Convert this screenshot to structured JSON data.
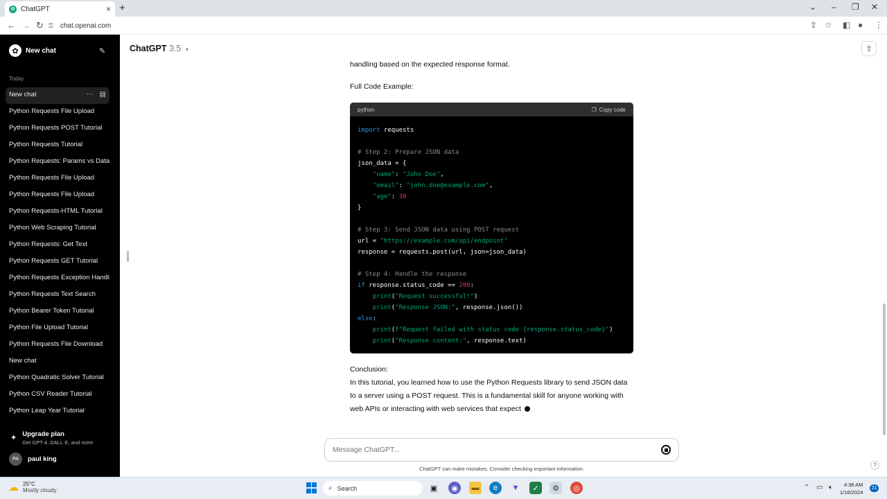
{
  "browser": {
    "tab_title": "ChatGPT",
    "url": "chat.openai.com"
  },
  "sidebar": {
    "new_chat_label": "New chat",
    "section_today": "Today",
    "history": [
      "New chat",
      "Python Requests File Upload",
      "Python Requests POST Tutorial",
      "Python Requests Tutorial",
      "Python Requests: Params vs Data",
      "Python Requests File Upload",
      "Python Requests File Upload",
      "Python Requests-HTML Tutorial",
      "Python Web Scraping Tutorial",
      "Python Requests: Get Text",
      "Python Requests GET Tutorial",
      "Python Requests Exception Handling",
      "Python Requests Text Search",
      "Python Bearer Token Tutorial",
      "Python File Upload Tutorial",
      "Python Requests File Download",
      "New chat",
      "Python Quadratic Solver Tutorial",
      "Python CSV Reader Tutorial",
      "Python Leap Year Tutorial"
    ],
    "upgrade_title": "Upgrade plan",
    "upgrade_subtitle": "Get GPT-4, DALL·E, and more",
    "user_initials": "PA",
    "user_name": "paul king"
  },
  "header": {
    "model_name": "ChatGPT",
    "model_version": "3.5"
  },
  "content": {
    "intro_tail": "handling based on the expected response format.",
    "full_code_label": "Full Code Example:",
    "code_language": "python",
    "copy_label": "Copy code",
    "code_lines": [
      [
        {
          "t": "import",
          "c": "kw"
        },
        {
          "t": " requests",
          "c": ""
        }
      ],
      [],
      [
        {
          "t": "# Step 2: Prepare JSON data",
          "c": "com"
        }
      ],
      [
        {
          "t": "json_data = {",
          "c": ""
        }
      ],
      [
        {
          "t": "    ",
          "c": ""
        },
        {
          "t": "\"name\"",
          "c": "str"
        },
        {
          "t": ": ",
          "c": ""
        },
        {
          "t": "\"John Doe\"",
          "c": "str"
        },
        {
          "t": ",",
          "c": ""
        }
      ],
      [
        {
          "t": "    ",
          "c": ""
        },
        {
          "t": "\"email\"",
          "c": "str"
        },
        {
          "t": ": ",
          "c": ""
        },
        {
          "t": "\"john.doe@example.com\"",
          "c": "str"
        },
        {
          "t": ",",
          "c": ""
        }
      ],
      [
        {
          "t": "    ",
          "c": ""
        },
        {
          "t": "\"age\"",
          "c": "str"
        },
        {
          "t": ": ",
          "c": ""
        },
        {
          "t": "30",
          "c": "num"
        }
      ],
      [
        {
          "t": "}",
          "c": ""
        }
      ],
      [],
      [
        {
          "t": "# Step 3: Send JSON data using POST request",
          "c": "com"
        }
      ],
      [
        {
          "t": "url = ",
          "c": ""
        },
        {
          "t": "\"https://example.com/api/endpoint\"",
          "c": "str"
        }
      ],
      [
        {
          "t": "response = requests.post(url, json=json_data)",
          "c": ""
        }
      ],
      [],
      [
        {
          "t": "# Step 4: Handle the response",
          "c": "com"
        }
      ],
      [
        {
          "t": "if",
          "c": "kw"
        },
        {
          "t": " response.status_code == ",
          "c": ""
        },
        {
          "t": "200",
          "c": "num"
        },
        {
          "t": ":",
          "c": ""
        }
      ],
      [
        {
          "t": "    ",
          "c": ""
        },
        {
          "t": "print",
          "c": "str"
        },
        {
          "t": "(",
          "c": ""
        },
        {
          "t": "\"Request successful!\"",
          "c": "str"
        },
        {
          "t": ")",
          "c": ""
        }
      ],
      [
        {
          "t": "    ",
          "c": ""
        },
        {
          "t": "print",
          "c": "str"
        },
        {
          "t": "(",
          "c": ""
        },
        {
          "t": "\"Response JSON:\"",
          "c": "str"
        },
        {
          "t": ", response.json())",
          "c": ""
        }
      ],
      [
        {
          "t": "else",
          "c": "kw"
        },
        {
          "t": ":",
          "c": ""
        }
      ],
      [
        {
          "t": "    ",
          "c": ""
        },
        {
          "t": "print",
          "c": "str"
        },
        {
          "t": "(",
          "c": ""
        },
        {
          "t": "f\"Request failed with status code {response.status_code}\"",
          "c": "str"
        },
        {
          "t": ")",
          "c": ""
        }
      ],
      [
        {
          "t": "    ",
          "c": ""
        },
        {
          "t": "print",
          "c": "str"
        },
        {
          "t": "(",
          "c": ""
        },
        {
          "t": "\"Response content:\"",
          "c": "str"
        },
        {
          "t": ", response.text)",
          "c": ""
        }
      ]
    ],
    "conclusion_label": "Conclusion:",
    "conclusion_lines": [
      "In this tutorial, you learned how to use the Python Requests library to send JSON data",
      "to a server using a POST request. This is a fundamental skill for anyone working with",
      "web APIs or interacting with web services that expect"
    ]
  },
  "composer": {
    "placeholder": "Message ChatGPT...",
    "disclaimer": "ChatGPT can make mistakes. Consider checking important information."
  },
  "taskbar": {
    "temperature": "25°C",
    "weather": "Mostly cloudy",
    "search_label": "Search",
    "time": "4:38 AM",
    "date": "1/16/2024",
    "notification_count": "21"
  },
  "colors": {
    "sidebar_bg": "#000000",
    "code_bg": "#000000",
    "code_keyword": "#2e95d3",
    "code_string": "#00a67d",
    "code_number": "#df3079",
    "code_comment": "#8a8a8a"
  }
}
